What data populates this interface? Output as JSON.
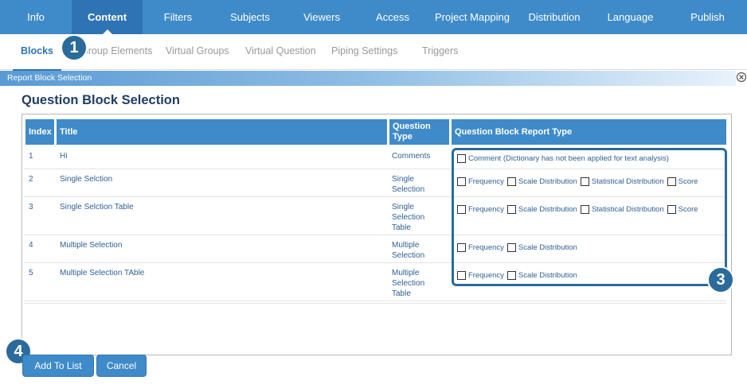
{
  "top_tabs": [
    "Info",
    "Content",
    "Filters",
    "Subjects",
    "Viewers",
    "Access",
    "Project Mapping",
    "Distribution",
    "Language",
    "Publish"
  ],
  "sub_tabs": [
    "Blocks",
    "Group Elements",
    "Virtual Groups",
    "Virtual Question",
    "Piping Settings",
    "Triggers"
  ],
  "panel_title": "Report Block Selection",
  "heading": "Question Block Selection",
  "table": {
    "headers": [
      "Index",
      "Title",
      "Question Type",
      "Question Block Report Type"
    ],
    "rows": [
      {
        "index": "1",
        "title": "Hi",
        "type": "Comments",
        "options": [
          "Comment (Dictionary has not been applied for text analysis)"
        ]
      },
      {
        "index": "2",
        "title": "Single Selction",
        "type": "Single Selection",
        "options": [
          "Frequency",
          "Scale Distribution",
          "Statistical Distribution",
          "Score"
        ]
      },
      {
        "index": "3",
        "title": "Single Selction Table",
        "type": "Single Selection Table",
        "options": [
          "Frequency",
          "Scale Distribution",
          "Statistical Distribution",
          "Score"
        ]
      },
      {
        "index": "4",
        "title": "Multiple Selection",
        "type": "Multiple Selection",
        "options": [
          "Frequency",
          "Scale Distribution"
        ]
      },
      {
        "index": "5",
        "title": "Multiple Selection TAble",
        "type": "Multiple Selection Table",
        "options": [
          "Frequency",
          "Scale Distribution"
        ]
      }
    ]
  },
  "buttons": {
    "add": "Add To List",
    "cancel": "Cancel"
  },
  "badges": [
    "1",
    "3",
    "4"
  ],
  "colors": {
    "nav": "#3f8bca",
    "nav_active": "#2e74b5",
    "badge": "#2a6b9c",
    "text": "#2f5f94"
  }
}
